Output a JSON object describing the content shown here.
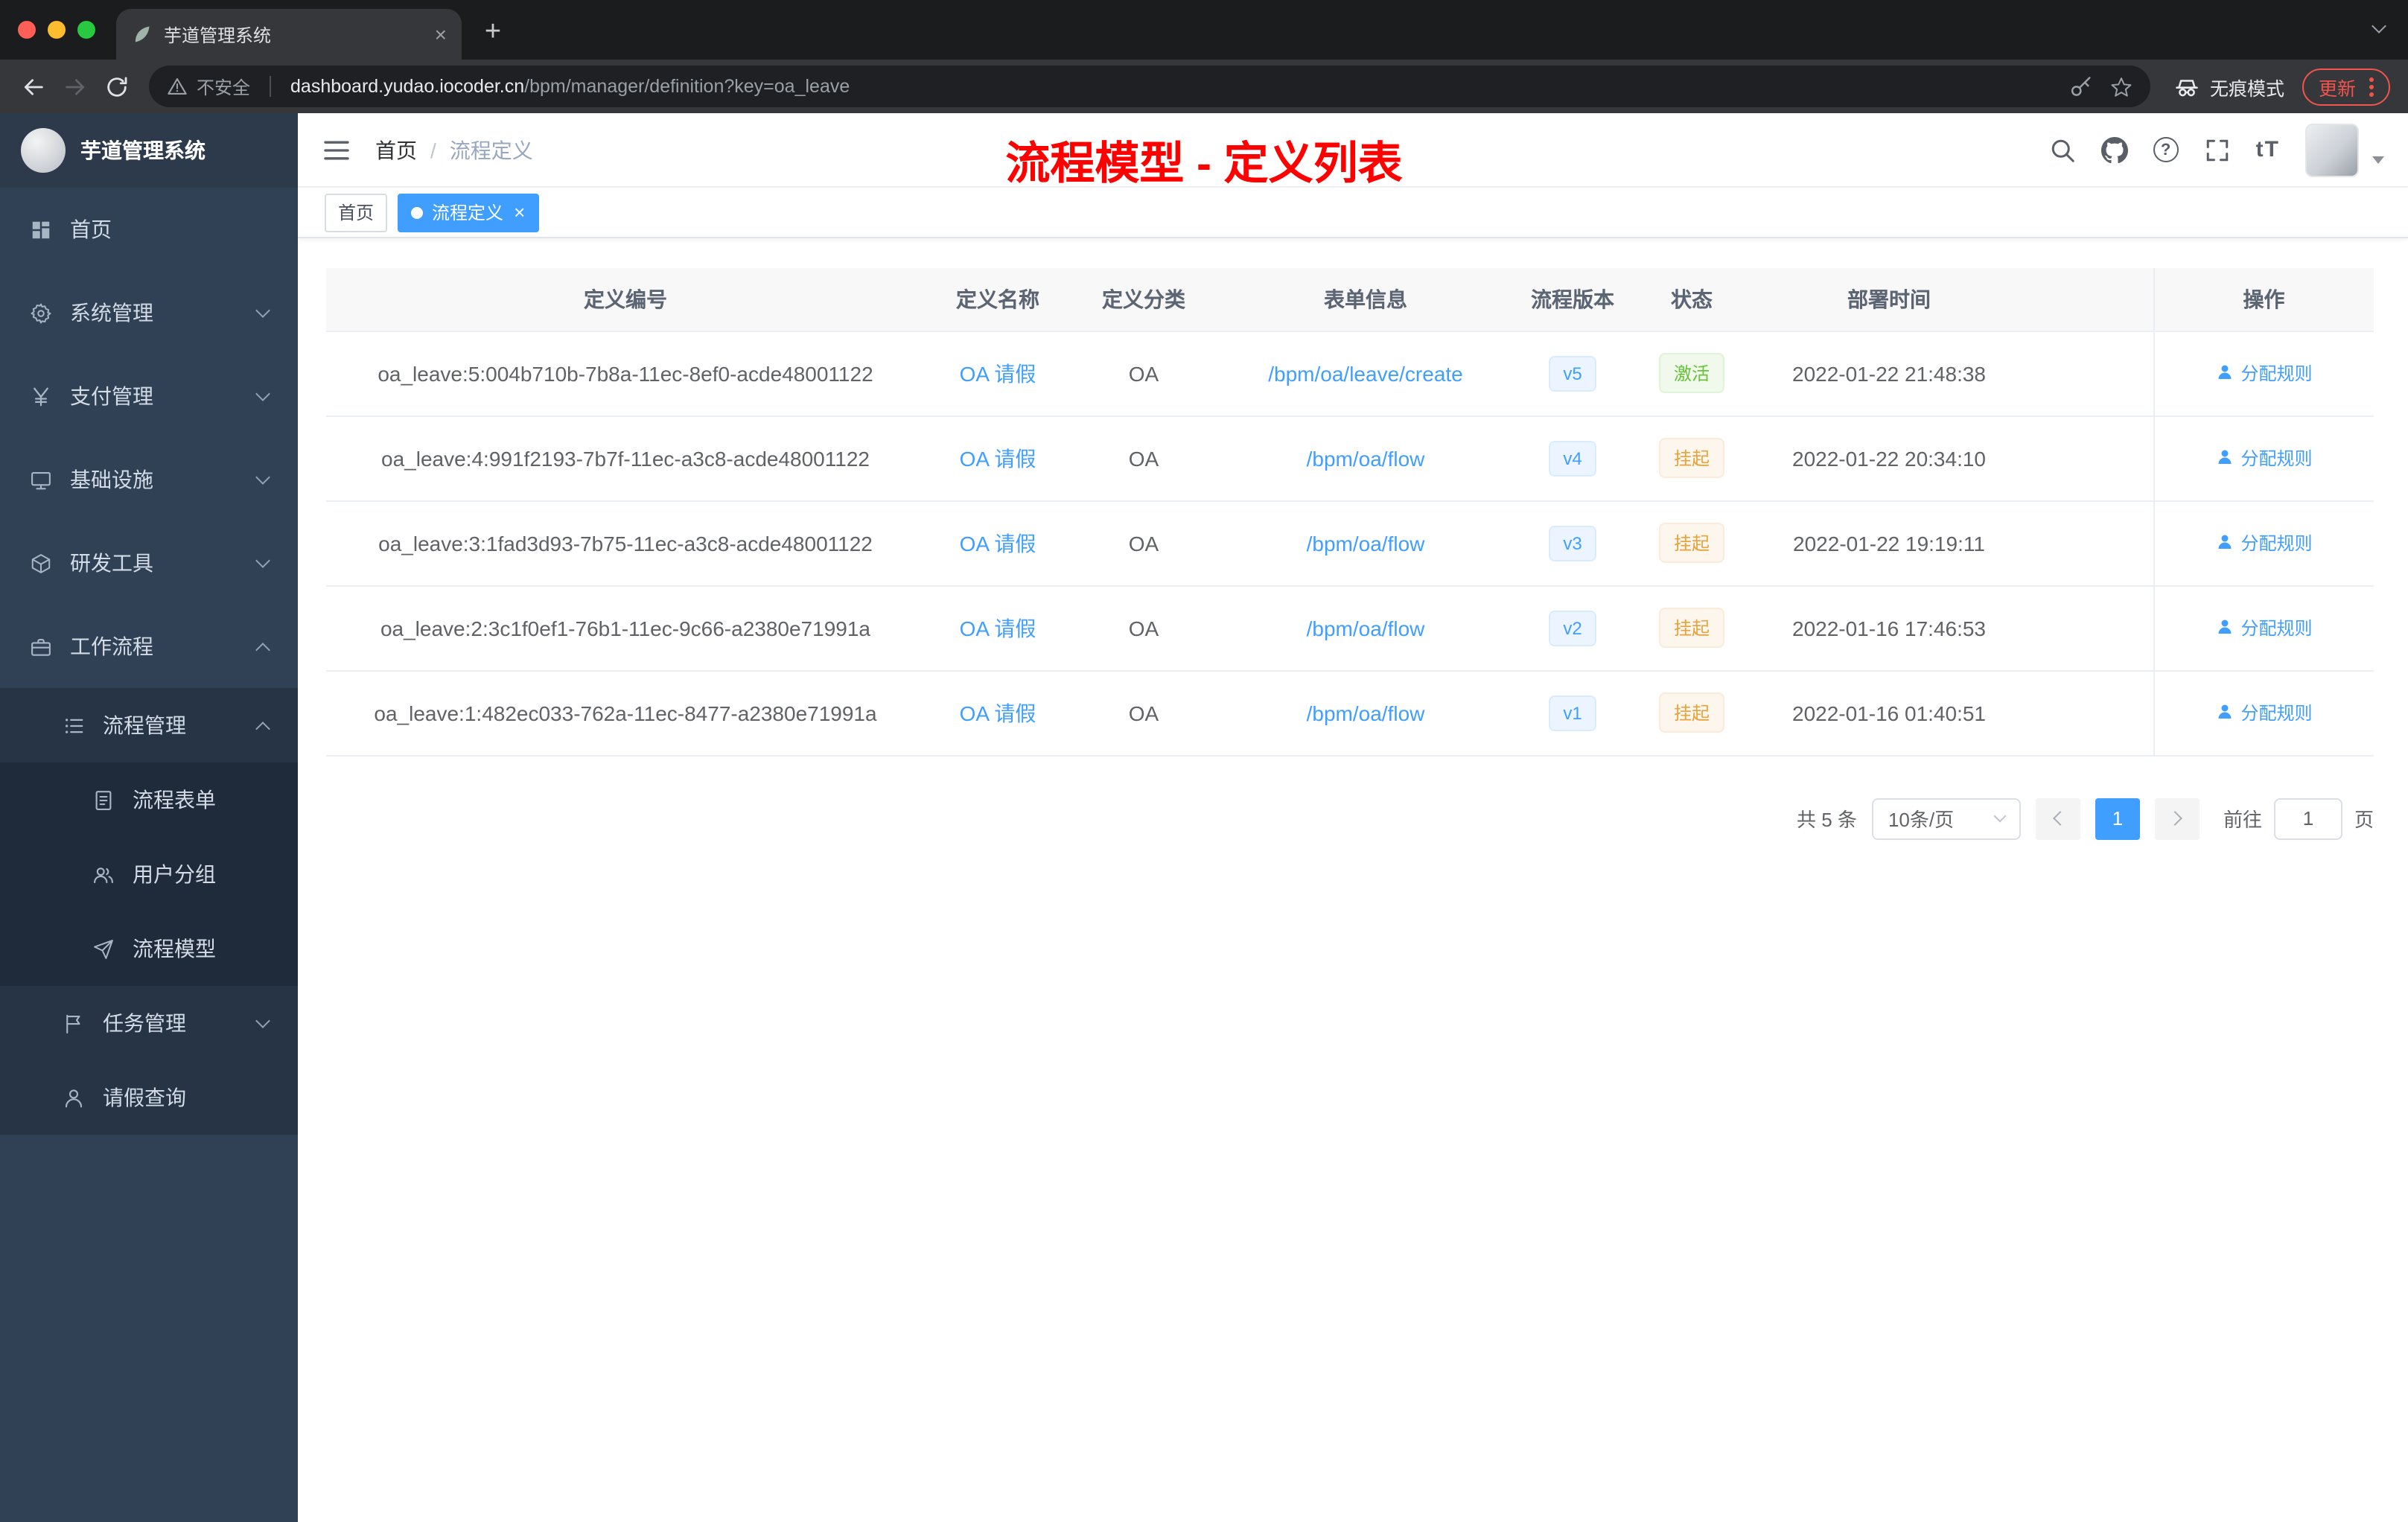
{
  "colors": {
    "accent": "#409eff",
    "annotation_red": "#ff0000",
    "status_active_green": "#67c23a",
    "status_suspend_orange": "#e6a23c"
  },
  "icons": {
    "close": "×",
    "new_tab": "+",
    "font_size": "tT",
    "help": "?"
  },
  "browser": {
    "tab_title": "芋道管理系统",
    "security_label": "不安全",
    "url_host": "dashboard.yudao.iocoder.cn",
    "url_path": "/bpm/manager/definition?key=oa_leave",
    "incognito_label": "无痕模式",
    "update_label": "更新"
  },
  "sidebar": {
    "app_title": "芋道管理系统",
    "items": [
      {
        "id": "home",
        "label": "首页",
        "icon": "grid",
        "level": 1
      },
      {
        "id": "system-mgmt",
        "label": "系统管理",
        "icon": "gear",
        "level": 1,
        "chevron": "down"
      },
      {
        "id": "payment-mgmt",
        "label": "支付管理",
        "icon": "yen",
        "level": 1,
        "chevron": "down"
      },
      {
        "id": "infrastructure",
        "label": "基础设施",
        "icon": "monitor",
        "level": 1,
        "chevron": "down"
      },
      {
        "id": "dev-tools",
        "label": "研发工具",
        "icon": "box",
        "level": 1,
        "chevron": "down"
      },
      {
        "id": "workflow",
        "label": "工作流程",
        "icon": "brief",
        "level": 1,
        "chevron": "up"
      },
      {
        "id": "process-mgmt",
        "label": "流程管理",
        "icon": "list",
        "level": 2,
        "chevron": "up"
      },
      {
        "id": "process-form",
        "label": "流程表单",
        "icon": "doc",
        "level": 3
      },
      {
        "id": "user-group",
        "label": "用户分组",
        "icon": "users",
        "level": 3
      },
      {
        "id": "process-model",
        "label": "流程模型",
        "icon": "send",
        "level": 3
      },
      {
        "id": "task-mgmt",
        "label": "任务管理",
        "icon": "flag",
        "level": 2,
        "chevron": "down"
      },
      {
        "id": "leave-query",
        "label": "请假查询",
        "icon": "user",
        "level": 2
      }
    ]
  },
  "header": {
    "breadcrumb": [
      "首页",
      "流程定义"
    ],
    "annotation": "流程模型 - 定义列表"
  },
  "tags": {
    "items": [
      {
        "label": "首页",
        "active": false
      },
      {
        "label": "流程定义",
        "active": true
      }
    ]
  },
  "table": {
    "columns": [
      "定义编号",
      "定义名称",
      "定义分类",
      "表单信息",
      "流程版本",
      "状态",
      "部署时间",
      "操作"
    ],
    "rows": [
      {
        "id": "oa_leave:5:004b710b-7b8a-11ec-8ef0-acde48001122",
        "name": "OA 请假",
        "category": "OA",
        "form": "/bpm/oa/leave/create",
        "version": "v5",
        "status": "激活",
        "status_type": "active",
        "time": "2022-01-22 21:48:38",
        "action": "分配规则"
      },
      {
        "id": "oa_leave:4:991f2193-7b7f-11ec-a3c8-acde48001122",
        "name": "OA 请假",
        "category": "OA",
        "form": "/bpm/oa/flow",
        "version": "v4",
        "status": "挂起",
        "status_type": "suspended",
        "time": "2022-01-22 20:34:10",
        "action": "分配规则"
      },
      {
        "id": "oa_leave:3:1fad3d93-7b75-11ec-a3c8-acde48001122",
        "name": "OA 请假",
        "category": "OA",
        "form": "/bpm/oa/flow",
        "version": "v3",
        "status": "挂起",
        "status_type": "suspended",
        "time": "2022-01-22 19:19:11",
        "action": "分配规则"
      },
      {
        "id": "oa_leave:2:3c1f0ef1-76b1-11ec-9c66-a2380e71991a",
        "name": "OA 请假",
        "category": "OA",
        "form": "/bpm/oa/flow",
        "version": "v2",
        "status": "挂起",
        "status_type": "suspended",
        "time": "2022-01-16 17:46:53",
        "action": "分配规则"
      },
      {
        "id": "oa_leave:1:482ec033-762a-11ec-8477-a2380e71991a",
        "name": "OA 请假",
        "category": "OA",
        "form": "/bpm/oa/flow",
        "version": "v1",
        "status": "挂起",
        "status_type": "suspended",
        "time": "2022-01-16 01:40:51",
        "action": "分配规则"
      }
    ]
  },
  "pagination": {
    "total": "共 5 条",
    "page_size": "10条/页",
    "current_page": "1",
    "goto_label": "前往",
    "goto_value": "1",
    "page_unit": "页"
  }
}
